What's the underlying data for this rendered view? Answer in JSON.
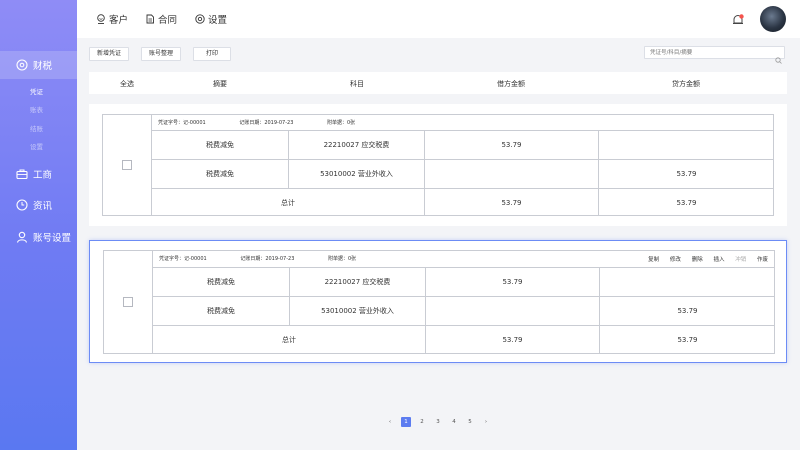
{
  "sidebar": {
    "items": [
      {
        "label": "财税",
        "icon": "circle-plus-icon"
      },
      {
        "label": "工商",
        "icon": "briefcase-icon"
      },
      {
        "label": "资讯",
        "icon": "clock-icon"
      },
      {
        "label": "账号设置",
        "icon": "user-icon"
      }
    ],
    "subitems": [
      "凭证",
      "账表",
      "结账",
      "设置"
    ]
  },
  "topnav": [
    {
      "label": "客户",
      "icon": "customer-icon"
    },
    {
      "label": "合同",
      "icon": "document-icon"
    },
    {
      "label": "设置",
      "icon": "settings-icon"
    }
  ],
  "toolbar": {
    "buttons": [
      "新增凭证",
      "账号整理",
      "打印"
    ],
    "search_placeholder": "凭证号/科目/摘要"
  },
  "header": {
    "select_all": "全选",
    "summary": "摘要",
    "subject": "科目",
    "debit": "借方金额",
    "credit": "贷方金额"
  },
  "vouchers": [
    {
      "voucher_no": "凭证字号：记-00001",
      "date": "记账日期：2019-07-23",
      "attachments": "附单据：0张",
      "rows": [
        {
          "summary": "税费减免",
          "subject": "22210027 应交税费",
          "debit": "53.79",
          "credit": ""
        },
        {
          "summary": "税费减免",
          "subject": "53010002 营业外收入",
          "debit": "",
          "credit": "53.79"
        }
      ],
      "total_label": "总计",
      "total_debit": "53.79",
      "total_credit": "53.79"
    },
    {
      "voucher_no": "凭证字号：记-00001",
      "date": "记账日期：2019-07-23",
      "attachments": "附单据：0张",
      "actions": [
        "复制",
        "修改",
        "删除",
        "插入",
        "冲销",
        "作废"
      ],
      "rows": [
        {
          "summary": "税费减免",
          "subject": "22210027 应交税费",
          "debit": "53.79",
          "credit": ""
        },
        {
          "summary": "税费减免",
          "subject": "53010002 营业外收入",
          "debit": "",
          "credit": "53.79"
        }
      ],
      "total_label": "总计",
      "total_debit": "53.79",
      "total_credit": "53.79"
    }
  ],
  "pagination": {
    "prev": "‹",
    "pages": [
      "1",
      "2",
      "3",
      "4",
      "5"
    ],
    "current": "1",
    "next": "›"
  },
  "colors": {
    "accent": "#5c7cf0",
    "sidebar_top": "#8f8cf6",
    "sidebar_bottom": "#5a78f1",
    "notification": "#f5534d"
  }
}
